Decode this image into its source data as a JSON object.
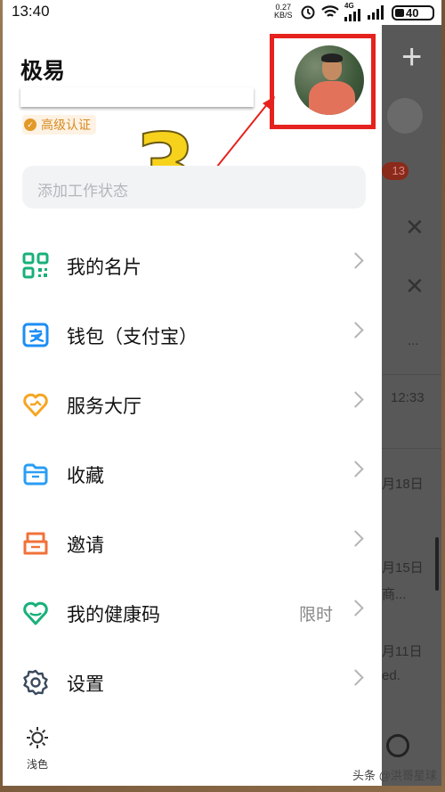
{
  "status_bar": {
    "time": "13:40",
    "net_speed_value": "0.27",
    "net_speed_unit": "KB/S",
    "network_type": "4G",
    "battery": "40"
  },
  "drawer": {
    "user_name": "极易",
    "cert_label": "高级认证",
    "work_status_placeholder": "添加工作状态",
    "menu": [
      {
        "label": "我的名片",
        "icon": "qr-code-icon"
      },
      {
        "label": "钱包（支付宝）",
        "icon": "alipay-icon"
      },
      {
        "label": "服务大厅",
        "icon": "service-hall-icon"
      },
      {
        "label": "收藏",
        "icon": "folder-icon"
      },
      {
        "label": "邀请",
        "icon": "invite-icon"
      },
      {
        "label": "我的健康码",
        "icon": "health-code-icon",
        "tag": "限时"
      },
      {
        "label": "设置",
        "icon": "gear-icon"
      }
    ],
    "theme_label": "浅色"
  },
  "annotation": {
    "step_number": "3",
    "color": "#e5221d",
    "number_color": "#f7d21d"
  },
  "background_app": {
    "badge": "13",
    "times": [
      "12:33",
      "月18日",
      "月15日",
      "月11日"
    ],
    "snippets": [
      "...",
      "商...",
      "ed."
    ]
  },
  "watermark": "头条 @洪哥星球",
  "colors": {
    "green": "#19b07a",
    "blue": "#1c8ef5",
    "orange": "#f5a623",
    "sky": "#2a9df4",
    "coral": "#f0723a"
  }
}
